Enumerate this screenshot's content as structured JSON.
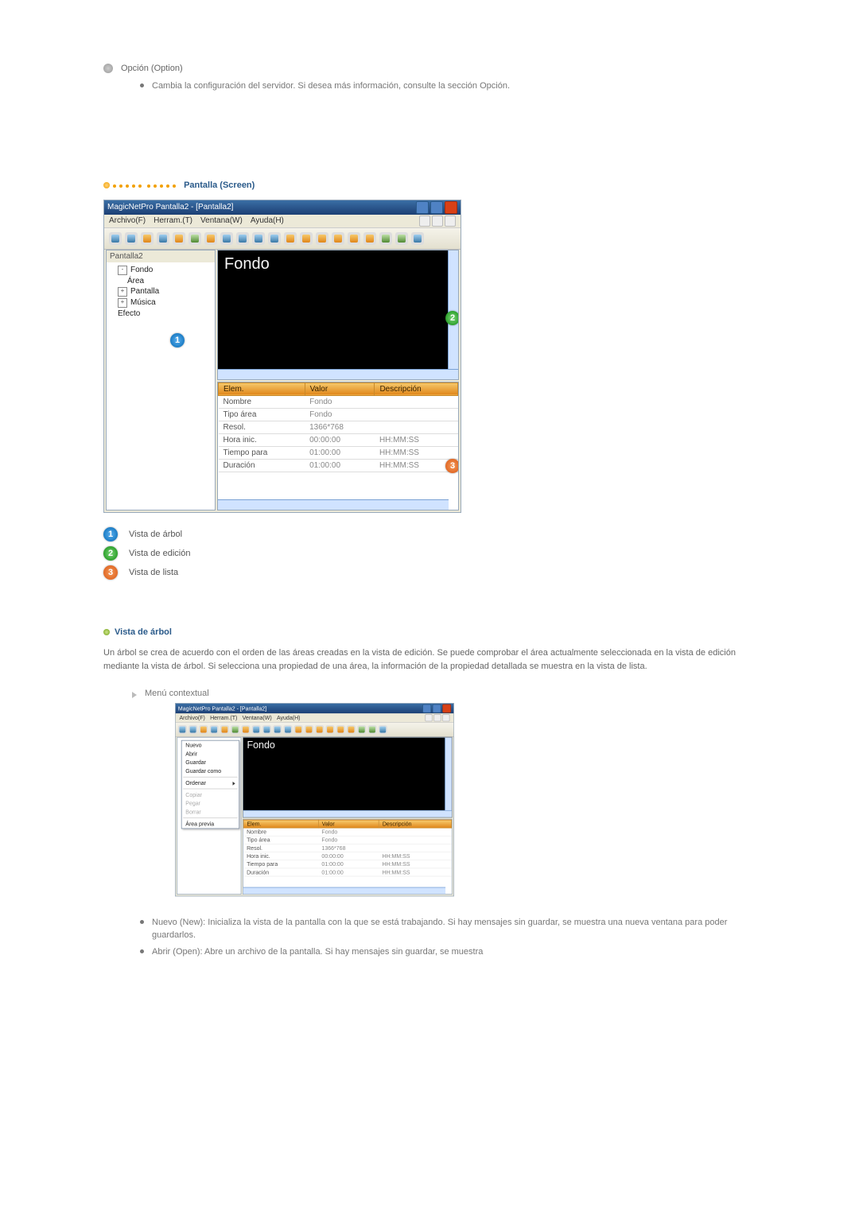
{
  "option": {
    "header": "Opción (Option)",
    "desc": "Cambia la configuración del servidor. Si desea más información, consulte la sección Opción."
  },
  "screen_section_title": "Pantalla (Screen)",
  "app": {
    "window_title": "MagicNetPro  Pantalla2 - [Pantalla2]",
    "menus": [
      "Archivo(F)",
      "Herram.(T)",
      "Ventana(W)",
      "Ayuda(H)"
    ],
    "tree_header": "Pantalla2",
    "tree_items": [
      "Fondo",
      "Área",
      "Pantalla",
      "Música",
      "Efecto"
    ],
    "preview_label": "Fondo",
    "grid": {
      "headers": [
        "Elem.",
        "Valor",
        "Descripción"
      ],
      "rows": [
        {
          "elem": "Nombre",
          "valor": "Fondo",
          "desc": ""
        },
        {
          "elem": "Tipo área",
          "valor": "Fondo",
          "desc": ""
        },
        {
          "elem": "Resol.",
          "valor": "1366*768",
          "desc": ""
        },
        {
          "elem": "Hora inic.",
          "valor": "00:00:00",
          "desc": "HH:MM:SS"
        },
        {
          "elem": "Tiempo para",
          "valor": "01:00:00",
          "desc": "HH:MM:SS"
        },
        {
          "elem": "Duración",
          "valor": "01:00:00",
          "desc": "HH:MM:SS"
        }
      ]
    }
  },
  "callouts": {
    "c1": "1",
    "c2": "2",
    "c3": "3"
  },
  "legend": {
    "l1": "Vista de árbol",
    "l2": "Vista de edición",
    "l3": "Vista de lista"
  },
  "treeview_section": {
    "title": "Vista de árbol",
    "paragraph": "Un árbol se crea de acuerdo con el orden de las áreas creadas en la vista de edición. Se puede comprobar el área actualmente seleccionada en la vista de edición mediante la vista de árbol. Si selecciona una propiedad de una área, la información de la propiedad detallada se muestra en la vista de lista.",
    "context_menu_label": "Menú contextual"
  },
  "context_menu": {
    "items": [
      {
        "label": "Nuevo",
        "disabled": false,
        "arrow": false
      },
      {
        "label": "Abrir",
        "disabled": false,
        "arrow": false
      },
      {
        "label": "Guardar",
        "disabled": false,
        "arrow": false
      },
      {
        "label": "Guardar como",
        "disabled": false,
        "arrow": false
      },
      {
        "sep": true
      },
      {
        "label": "Ordenar",
        "disabled": false,
        "arrow": true
      },
      {
        "sep": true
      },
      {
        "label": "Copiar",
        "disabled": true,
        "arrow": false
      },
      {
        "label": "Pegar",
        "disabled": true,
        "arrow": false
      },
      {
        "label": "Borrar",
        "disabled": true,
        "arrow": false
      },
      {
        "sep": true
      },
      {
        "label": "Área previa",
        "disabled": false,
        "arrow": false
      }
    ]
  },
  "descriptions": {
    "nuevo": "Nuevo (New): Inicializa la vista de la pantalla con la que se está trabajando. Si hay mensajes sin guardar, se muestra una nueva ventana para poder guardarlos.",
    "abrir": "Abrir (Open): Abre un archivo de la pantalla. Si hay mensajes sin guardar, se muestra"
  }
}
